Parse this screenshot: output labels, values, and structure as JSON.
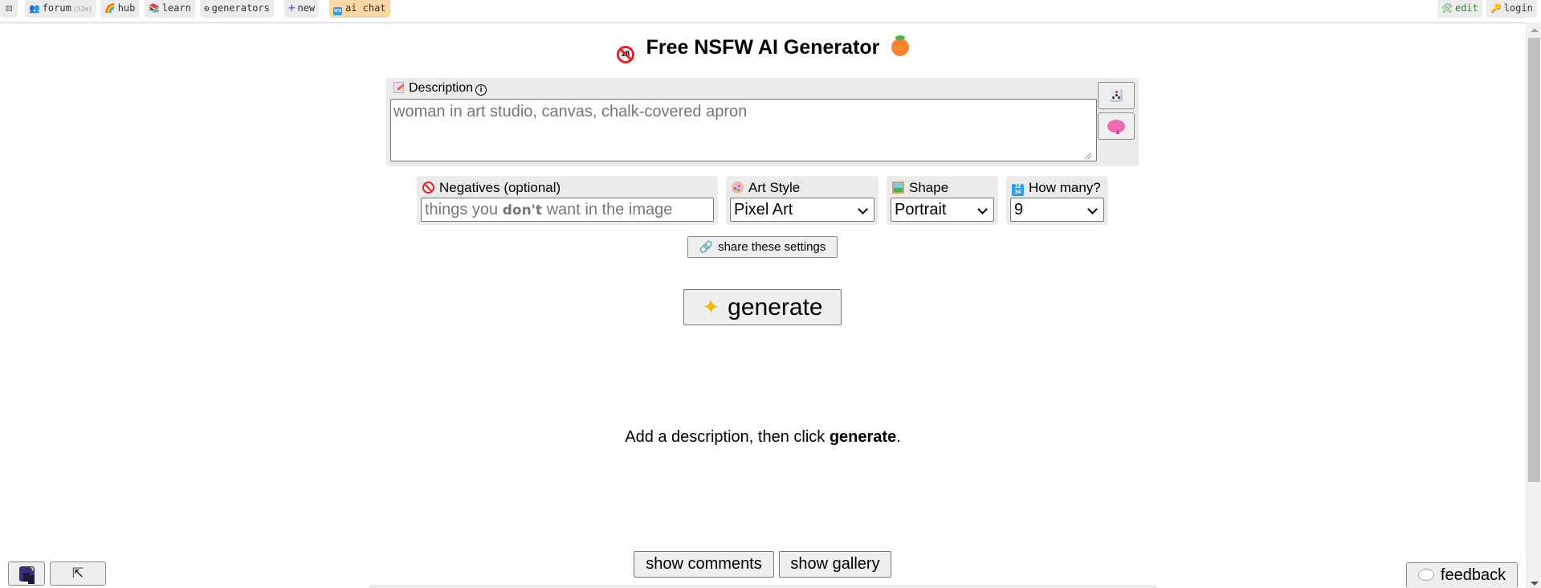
{
  "nav": {
    "left": [
      {
        "name": "random",
        "icon": "dice-icon",
        "glyph": "⚄",
        "label": ""
      },
      {
        "name": "forum",
        "icon": "people-icon",
        "glyph": "👥",
        "label": "forum",
        "sub": "(52m)"
      },
      {
        "name": "hub",
        "icon": "rainbow-icon",
        "glyph": "🌈",
        "label": "hub"
      },
      {
        "name": "learn",
        "icon": "books-icon",
        "glyph": "📚",
        "label": "learn"
      },
      {
        "name": "generators",
        "icon": "gears-icon",
        "glyph": "⚙",
        "label": "generators"
      },
      {
        "name": "new",
        "icon": "plus-icon",
        "glyph": "+",
        "label": "new"
      },
      {
        "name": "ai-chat",
        "icon": "new-badge-icon",
        "glyph": "NEW",
        "label": "ai chat"
      }
    ],
    "right": [
      {
        "name": "edit",
        "icon": "tools-icon",
        "glyph": "🛠",
        "label": "edit"
      },
      {
        "name": "login",
        "icon": "key-icon",
        "glyph": "🔑",
        "label": "login"
      }
    ]
  },
  "title": "Free NSFW AI Generator",
  "description": {
    "label": "Description",
    "info_glyph": "i",
    "placeholder": "woman in art studio, canvas, chalk-covered apron",
    "value": ""
  },
  "negatives": {
    "label": "Negatives (optional)",
    "placeholder_pre": "things you ",
    "placeholder_bold": "don't",
    "placeholder_post": " want in the image"
  },
  "art_style": {
    "label": "Art Style",
    "value": "Pixel Art"
  },
  "shape": {
    "label": "Shape",
    "value": "Portrait"
  },
  "how_many": {
    "label": "How many?",
    "value": "9",
    "icon_glyph": "1234"
  },
  "share_button": {
    "icon_glyph": "🔗",
    "label": "share these settings"
  },
  "generate_button": {
    "icon_glyph": "✨",
    "label": "generate"
  },
  "hint": {
    "pre": "Add a description, then click ",
    "bold": "generate",
    "post": "."
  },
  "bottom": {
    "show_comments": "show comments",
    "show_gallery": "show gallery",
    "back_to_top_glyph": "⇱",
    "feedback": "feedback"
  },
  "colors": {
    "panel_bg": "#ebebeb",
    "ai_chat_bg": "#fcd6a5",
    "edit_text": "#2e8b2e",
    "no18_red": "#e02424"
  }
}
